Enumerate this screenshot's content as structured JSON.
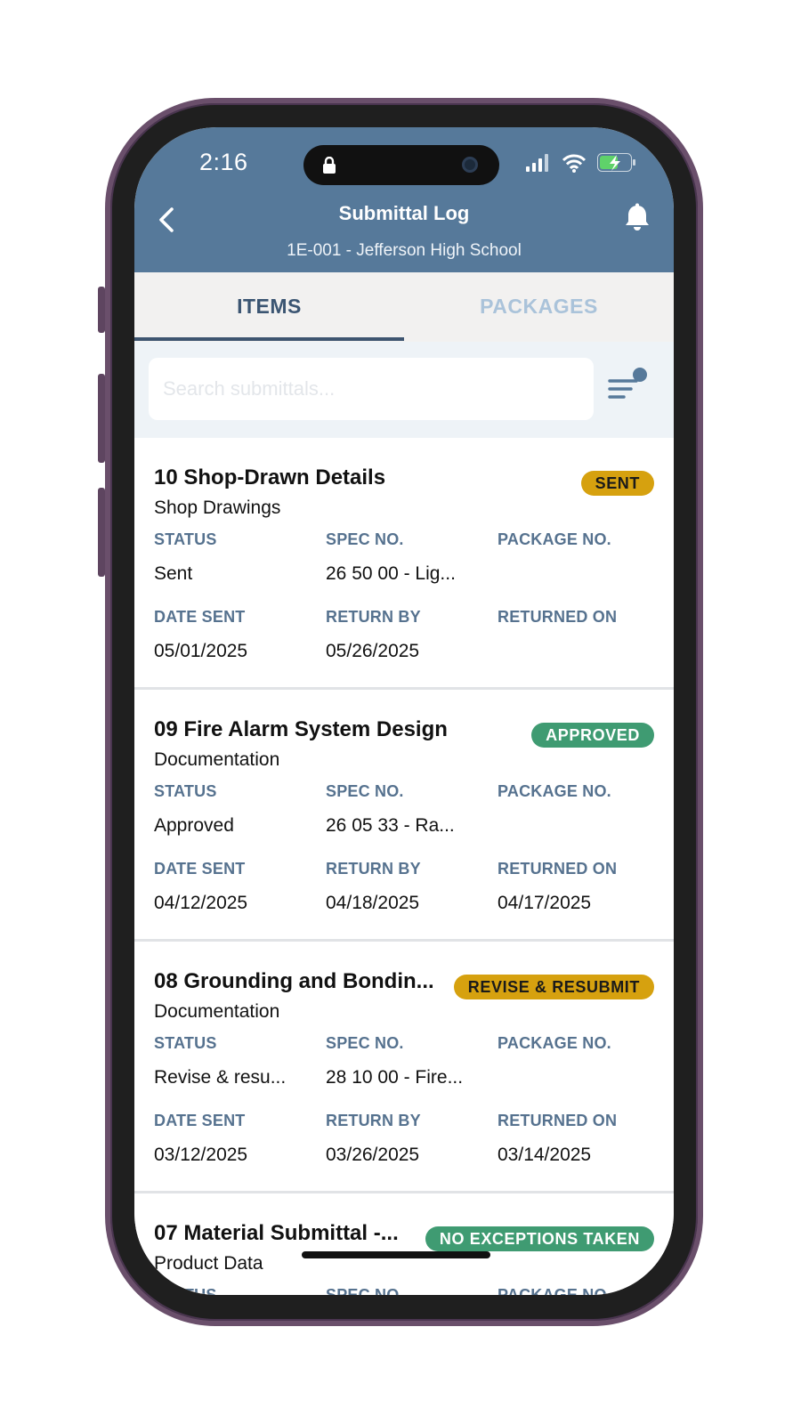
{
  "status_bar": {
    "time": "2:16"
  },
  "header": {
    "title": "Submittal Log",
    "subtitle": "1E-001 - Jefferson High School"
  },
  "tabs": [
    {
      "label": "ITEMS",
      "active": true
    },
    {
      "label": "PACKAGES",
      "active": false
    }
  ],
  "search": {
    "placeholder": "Search submittals...",
    "value": ""
  },
  "field_labels": {
    "status": "STATUS",
    "spec_no": "SPEC NO.",
    "package_no": "PACKAGE NO.",
    "date_sent": "DATE SENT",
    "return_by": "RETURN BY",
    "returned_on": "RETURNED ON"
  },
  "items": [
    {
      "title": "10 Shop-Drawn Details",
      "type": "Shop Drawings",
      "badge": "SENT",
      "badge_color": "#d6a10f",
      "status": "Sent",
      "spec_no": "26 50 00 - Lig...",
      "package_no": "",
      "date_sent": "05/01/2025",
      "return_by": "05/26/2025",
      "returned_on": ""
    },
    {
      "title": "09 Fire Alarm System Design",
      "type": "Documentation",
      "badge": "APPROVED",
      "badge_color": "#3f9b72",
      "status": "Approved",
      "spec_no": "26 05 33 - Ra...",
      "package_no": "",
      "date_sent": "04/12/2025",
      "return_by": "04/18/2025",
      "returned_on": "04/17/2025"
    },
    {
      "title": "08 Grounding and Bondin...",
      "type": "Documentation",
      "badge": "REVISE & RESUBMIT",
      "badge_color": "#d6a10f",
      "status": "Revise & resu...",
      "spec_no": "28 10 00 - Fire...",
      "package_no": "",
      "date_sent": "03/12/2025",
      "return_by": "03/26/2025",
      "returned_on": "03/14/2025"
    },
    {
      "title": "07 Material Submittal -...",
      "type": "Product Data",
      "badge": "NO EXCEPTIONS TAKEN",
      "badge_color": "#3f9b72",
      "status": "",
      "spec_no": "",
      "package_no": "",
      "date_sent": "",
      "return_by": "",
      "returned_on": ""
    }
  ],
  "colors": {
    "header_bg": "#56799a",
    "tab_active": "#3b5572",
    "tab_inactive": "#aac3da",
    "field_label": "#56728f"
  }
}
